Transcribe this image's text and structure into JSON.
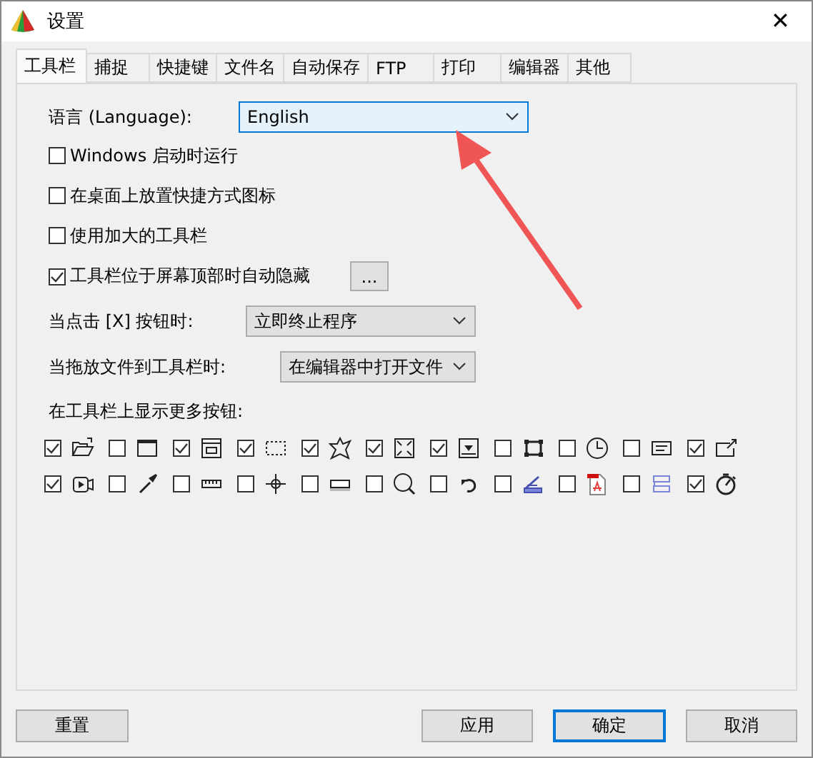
{
  "window": {
    "title": "设置",
    "close": "✕"
  },
  "tabs": [
    {
      "label": "工具栏",
      "selected": true
    },
    {
      "label": "捕捉",
      "selected": false
    },
    {
      "label": "快捷键",
      "selected": false
    },
    {
      "label": "文件名",
      "selected": false
    },
    {
      "label": "自动保存",
      "selected": false
    },
    {
      "label": "FTP",
      "selected": false
    },
    {
      "label": "打印",
      "selected": false
    },
    {
      "label": "编辑器",
      "selected": false
    },
    {
      "label": "其他",
      "selected": false
    }
  ],
  "language": {
    "label": "语言 (Language):",
    "value": "English"
  },
  "options": [
    {
      "label": "Windows 启动时运行",
      "checked": false
    },
    {
      "label": "在桌面上放置快捷方式图标",
      "checked": false
    },
    {
      "label": "使用加大的工具栏",
      "checked": false
    },
    {
      "label": "工具栏位于屏幕顶部时自动隐藏",
      "checked": true,
      "button": "..."
    }
  ],
  "close_action": {
    "label": "当点击 [X] 按钮时:",
    "value": "立即终止程序"
  },
  "drop_action": {
    "label": "当拖放文件到工具栏时:",
    "value": "在编辑器中打开文件"
  },
  "more_buttons": {
    "label": "在工具栏上显示更多按钮:",
    "rows": [
      [
        {
          "checked": true
        },
        {
          "checked": false
        },
        {
          "checked": true
        },
        {
          "checked": true
        },
        {
          "checked": true
        },
        {
          "checked": true
        },
        {
          "checked": true
        },
        {
          "checked": false
        },
        {
          "checked": false
        },
        {
          "checked": false
        },
        {
          "checked": true
        }
      ],
      [
        {
          "checked": true
        },
        {
          "checked": false
        },
        {
          "checked": false
        },
        {
          "checked": false
        },
        {
          "checked": false
        },
        {
          "checked": false
        },
        {
          "checked": false
        },
        {
          "checked": false
        },
        {
          "checked": false
        },
        {
          "checked": false
        },
        {
          "checked": true
        }
      ]
    ]
  },
  "buttons": [
    {
      "label": "重置",
      "kind": "reset"
    },
    {
      "label": "应用",
      "kind": "apply"
    },
    {
      "label": "确定",
      "kind": "ok"
    },
    {
      "label": "取消",
      "kind": "cancel"
    }
  ]
}
